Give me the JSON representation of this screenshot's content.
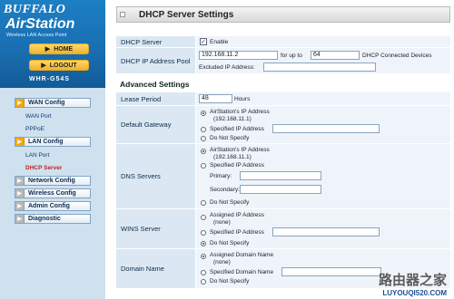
{
  "sidebar": {
    "brand": "BUFFALO",
    "product": "AirStation",
    "tagline": "Wireless LAN Access Point",
    "home_label": "HOME",
    "logout_label": "LOGOUT",
    "model": "WHR-G54S",
    "menu": [
      {
        "label": "WAN Config"
      },
      {
        "sub": "WAN Port"
      },
      {
        "sub": "PPPoE"
      },
      {
        "label": "LAN Config"
      },
      {
        "sub": "LAN Port"
      },
      {
        "sub": "DHCP Server"
      },
      {
        "label": "Network Config"
      },
      {
        "label": "Wireless Config"
      },
      {
        "label": "Admin Config"
      },
      {
        "label": "Diagnostic"
      }
    ]
  },
  "header": {
    "title": "DHCP Server Settings"
  },
  "form": {
    "dhcp_server": {
      "label": "DHCP Server",
      "checkbox_label": "Enable",
      "checked": true
    },
    "dhcp_range": {
      "label": "DHCP IP Address Pool",
      "start_value": "192.168.11.2",
      "for_up_to": "for up to",
      "count_value": "64",
      "connected_devices": "DHCP Connected Devices",
      "excluded_label": "Excluded IP Address:",
      "excluded_value": ""
    },
    "advanced_title": "Advanced Settings",
    "lease": {
      "label": "Lease Period",
      "value": "48",
      "unit": "Hours"
    },
    "gateway": {
      "label": "Default Gateway",
      "opt1": "AirStation's IP Address",
      "opt1_sub": "(192.168.11.1)",
      "opt2": "Specified IP Address",
      "opt3": "Do Not Specify"
    },
    "dns": {
      "label": "DNS Servers",
      "opt1": "AirStation's IP Address",
      "opt1_sub": "(192.168.11.1)",
      "opt2": "Specified IP Address",
      "primary_label": "Primary:",
      "secondary_label": "Secondary:",
      "opt3": "Do Not Specify"
    },
    "wins": {
      "label": "WINS Server",
      "opt1": "Assigned IP Address",
      "opt1_sub": "(none)",
      "opt2": "Specified IP Address",
      "opt3": "Do Not Specify"
    },
    "domain": {
      "label": "Domain Name",
      "opt1": "Assigned Domain Name",
      "opt1_sub": "(none)",
      "opt2": "Specified Domain Name",
      "opt3": "Do Not Specify"
    }
  },
  "watermark": {
    "main": "路由器之家",
    "url": "LUYOUQI520.COM"
  }
}
